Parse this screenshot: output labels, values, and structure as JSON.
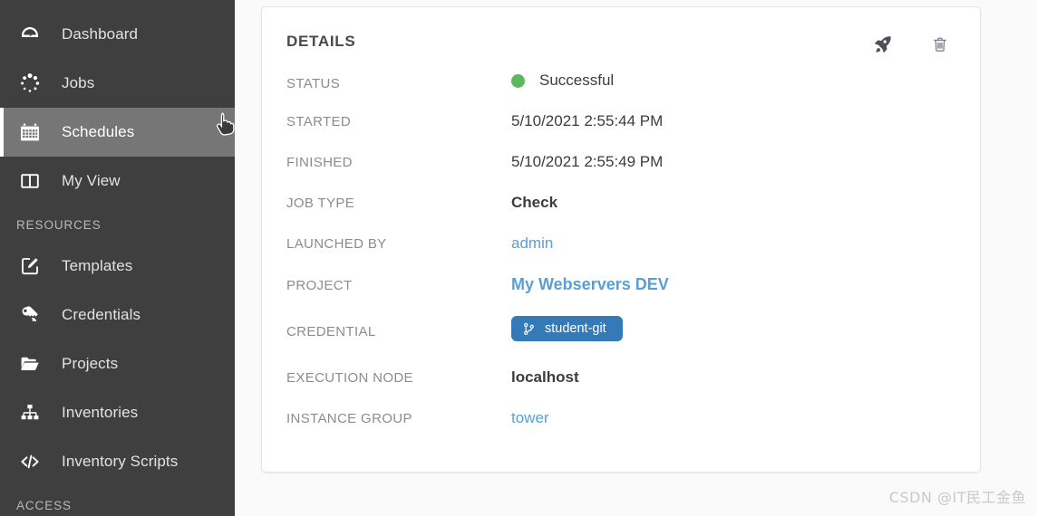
{
  "sidebar": {
    "items": [
      {
        "label": "Dashboard",
        "icon": "dashboard-gauge-icon",
        "name": "dashboard",
        "active": false
      },
      {
        "label": "Jobs",
        "icon": "jobs-spinner-icon",
        "name": "jobs",
        "active": false
      },
      {
        "label": "Schedules",
        "icon": "calendar-icon",
        "name": "schedules",
        "active": true
      },
      {
        "label": "My View",
        "icon": "columns-icon",
        "name": "my-view",
        "active": false
      }
    ],
    "sections": [
      {
        "title": "RESOURCES",
        "items": [
          {
            "label": "Templates",
            "icon": "pencil-square-icon",
            "name": "templates"
          },
          {
            "label": "Credentials",
            "icon": "key-icon",
            "name": "credentials"
          },
          {
            "label": "Projects",
            "icon": "folder-open-icon",
            "name": "projects"
          },
          {
            "label": "Inventories",
            "icon": "sitemap-icon",
            "name": "inventories"
          },
          {
            "label": "Inventory Scripts",
            "icon": "code-icon",
            "name": "inventory-scripts"
          }
        ]
      },
      {
        "title": "ACCESS",
        "items": []
      }
    ]
  },
  "details": {
    "title": "DETAILS",
    "actions": [
      {
        "label": "Relaunch",
        "icon": "rocket-icon",
        "name": "relaunch-button"
      },
      {
        "label": "Delete",
        "icon": "trash-icon",
        "name": "delete-button"
      }
    ],
    "rows": [
      {
        "label": "STATUS",
        "value": "Successful",
        "kind": "status",
        "dot_color": "#5cb85c"
      },
      {
        "label": "STARTED",
        "value": "5/10/2021 2:55:44 PM",
        "kind": "text"
      },
      {
        "label": "FINISHED",
        "value": "5/10/2021 2:55:49 PM",
        "kind": "text"
      },
      {
        "label": "JOB TYPE",
        "value": "Check",
        "kind": "bold"
      },
      {
        "label": "LAUNCHED BY",
        "value": "admin",
        "kind": "link"
      },
      {
        "label": "PROJECT",
        "value": "My Webservers DEV",
        "kind": "link-strong"
      },
      {
        "label": "CREDENTIAL",
        "value": "student-git",
        "kind": "badge",
        "badge_icon": "git-branch-icon",
        "badge_color": "#337ab7"
      },
      {
        "label": "EXECUTION NODE",
        "value": "localhost",
        "kind": "bold"
      },
      {
        "label": "INSTANCE GROUP",
        "value": "tower",
        "kind": "link"
      }
    ]
  },
  "watermark": {
    "text": "CSDN @IT民工金鱼"
  },
  "colors": {
    "sidebar_bg": "#3f3f3f",
    "sidebar_active_bg": "#767676",
    "link": "#5a9fd4",
    "badge": "#337ab7",
    "status_success": "#5cb85c",
    "page_bg": "#fafafa"
  }
}
